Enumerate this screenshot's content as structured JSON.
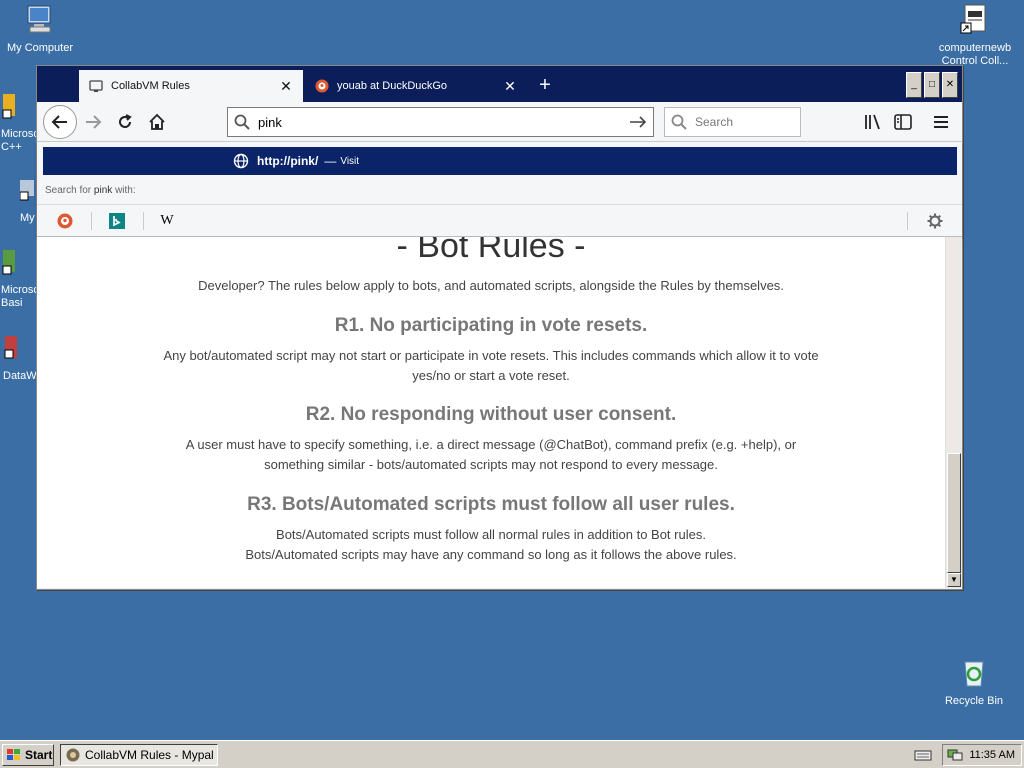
{
  "desktop": {
    "icons": [
      {
        "label": "My Computer"
      },
      {
        "label": "computernewb Control Coll..."
      },
      {
        "label": "Recycle Bin"
      }
    ],
    "partial_icons": [
      {
        "label": "Microso C++"
      },
      {
        "label": "My"
      },
      {
        "label": "Microso Basi"
      },
      {
        "label": "DataW"
      }
    ]
  },
  "browser": {
    "tabs": [
      {
        "title": "CollabVM Rules",
        "active": true
      },
      {
        "title": "youab at DuckDuckGo",
        "active": false
      }
    ],
    "new_tab": "+",
    "window_buttons": {
      "minimize": "_",
      "maximize": "□",
      "close": "✕"
    },
    "url_value": "pink",
    "search_placeholder": "Search",
    "suggestion": {
      "url": "http://pink/",
      "separator": "—",
      "action": "Visit"
    },
    "search_for": {
      "prefix": "Search for",
      "term": "pink",
      "suffix": "with:"
    },
    "engines": [
      "DuckDuckGo",
      "Bing",
      "Wikipedia"
    ],
    "wiki_glyph": "W"
  },
  "page": {
    "heading": "- Bot Rules -",
    "intro": "Developer? The rules below apply to bots, and automated scripts, alongside the Rules by themselves.",
    "rules": [
      {
        "title": "R1. No participating in vote resets.",
        "lines": [
          "Any bot/automated script may not start or participate in vote resets. This includes commands which allow it to vote",
          "yes/no or start a vote reset."
        ]
      },
      {
        "title": "R2. No responding without user consent.",
        "lines": [
          "A user must have to specify something, i.e. a direct message (@ChatBot), command prefix (e.g. +help), or",
          "something similar - bots/automated scripts may not respond to every message."
        ]
      },
      {
        "title": "R3. Bots/Automated scripts must follow all user rules.",
        "lines": [
          "Bots/Automated scripts must follow all normal rules in addition to Bot rules.",
          "Bots/Automated scripts may have any command so long as it follows the above rules."
        ]
      }
    ]
  },
  "taskbar": {
    "start_label": "Start",
    "task_label": "CollabVM Rules - Mypal",
    "clock": "11:35 AM"
  },
  "colors": {
    "desktop": "#3a6ea5",
    "tabbar": "#0c1e5a",
    "suggestion_highlight": "#0b2469"
  }
}
